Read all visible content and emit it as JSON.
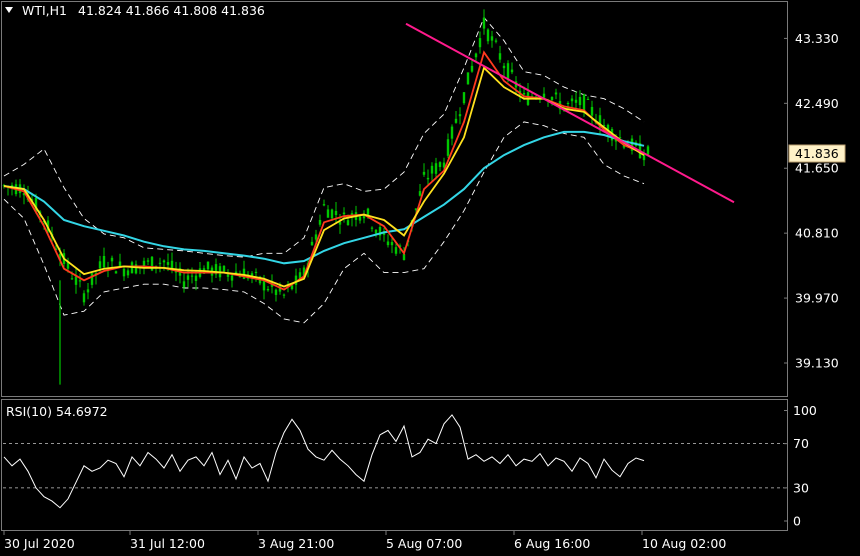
{
  "header": {
    "symbol": "WTI,H1",
    "ohlc": "41.824 41.866 41.808 41.836"
  },
  "price_badge": "41.836",
  "rsi_label": "RSI(10) 54.6972",
  "colors": {
    "background": "#000000",
    "candles": "#00c800",
    "ma_fast": "#ff3a1e",
    "ma_mid": "#ffe11e",
    "ma_slow": "#33d6e6",
    "bands": "#ffffff",
    "trendline": "#ff1a8c",
    "rsi": "#ffffff",
    "badge_bg": "#fff2c8"
  },
  "chart_data": [
    {
      "type": "line",
      "panel": "price",
      "symbol": "WTI,H1",
      "yticks": [
        43.33,
        42.49,
        41.65,
        40.81,
        39.97,
        39.13
      ],
      "yticks_text": [
        "43.330",
        "42.490",
        "41.650",
        "40.810",
        "39.970",
        "39.130"
      ],
      "ylim": [
        38.77,
        43.54
      ],
      "xticks": [
        "30 Jul 2020",
        "31 Jul 12:00",
        "3 Aug 21:00",
        "5 Aug 07:00",
        "6 Aug 16:00",
        "10 Aug 02:00"
      ],
      "current_price": 41.836,
      "series": [
        {
          "name": "",
          "role": "close",
          "x": [
            0,
            5,
            10,
            15,
            20,
            25,
            30,
            35,
            40,
            45,
            50,
            55,
            60,
            65,
            70,
            75,
            80,
            85,
            90,
            95,
            100,
            105,
            110,
            115,
            120,
            125,
            130,
            135,
            140,
            145,
            150,
            155,
            160
          ],
          "values": [
            41.42,
            41.4,
            41.0,
            40.45,
            40.02,
            40.45,
            40.35,
            40.4,
            40.45,
            40.2,
            40.35,
            40.3,
            40.3,
            40.15,
            40.0,
            40.28,
            41.15,
            41.0,
            41.1,
            40.75,
            40.55,
            41.5,
            41.75,
            42.6,
            43.5,
            43.0,
            42.55,
            42.65,
            42.45,
            42.5,
            42.2,
            42.0,
            41.84
          ]
        },
        {
          "name": "",
          "role": "ma_fast",
          "x": [
            0,
            5,
            10,
            15,
            20,
            25,
            30,
            35,
            40,
            45,
            50,
            55,
            60,
            65,
            70,
            75,
            80,
            85,
            90,
            95,
            100,
            105,
            110,
            115,
            120,
            125,
            130,
            135,
            140,
            145,
            150,
            155,
            160
          ],
          "values": [
            41.42,
            41.35,
            40.9,
            40.35,
            40.2,
            40.32,
            40.38,
            40.38,
            40.36,
            40.3,
            40.3,
            40.3,
            40.25,
            40.2,
            40.08,
            40.25,
            40.95,
            41.03,
            41.05,
            40.9,
            40.55,
            41.38,
            41.62,
            42.25,
            43.15,
            42.78,
            42.58,
            42.55,
            42.45,
            42.4,
            42.15,
            41.95,
            41.84
          ]
        },
        {
          "name": "",
          "role": "ma_mid",
          "x": [
            0,
            5,
            10,
            15,
            20,
            25,
            30,
            35,
            40,
            45,
            50,
            55,
            60,
            65,
            70,
            75,
            80,
            85,
            90,
            95,
            100,
            105,
            110,
            115,
            120,
            125,
            130,
            135,
            140,
            145,
            150,
            155,
            160
          ],
          "values": [
            41.42,
            41.38,
            40.98,
            40.48,
            40.28,
            40.35,
            40.38,
            40.36,
            40.36,
            40.33,
            40.32,
            40.3,
            40.27,
            40.22,
            40.12,
            40.22,
            40.85,
            41.0,
            41.05,
            40.98,
            40.78,
            41.22,
            41.58,
            42.05,
            42.95,
            42.7,
            42.55,
            42.55,
            42.42,
            42.38,
            42.18,
            41.98,
            41.82
          ]
        },
        {
          "name": "",
          "role": "ma_slow",
          "x": [
            0,
            5,
            10,
            15,
            20,
            25,
            30,
            35,
            40,
            45,
            50,
            55,
            60,
            65,
            70,
            75,
            80,
            85,
            90,
            95,
            100,
            105,
            110,
            115,
            120,
            125,
            130,
            135,
            140,
            145,
            150,
            155,
            160
          ],
          "values": [
            41.42,
            41.38,
            41.22,
            40.98,
            40.9,
            40.84,
            40.78,
            40.7,
            40.64,
            40.6,
            40.58,
            40.55,
            40.52,
            40.48,
            40.42,
            40.45,
            40.58,
            40.68,
            40.75,
            40.82,
            40.86,
            41.02,
            41.18,
            41.38,
            41.65,
            41.82,
            41.95,
            42.05,
            42.12,
            42.12,
            42.08,
            42.0,
            41.94
          ]
        },
        {
          "name": "",
          "role": "band_upper",
          "x": [
            0,
            5,
            10,
            15,
            20,
            25,
            30,
            35,
            40,
            45,
            50,
            55,
            60,
            65,
            70,
            75,
            80,
            85,
            90,
            95,
            100,
            105,
            110,
            115,
            120,
            125,
            130,
            135,
            140,
            145,
            150,
            155,
            160
          ],
          "values": [
            41.55,
            41.7,
            41.9,
            41.4,
            41.0,
            40.8,
            40.75,
            40.62,
            40.6,
            40.58,
            40.55,
            40.52,
            40.5,
            40.55,
            40.55,
            40.75,
            41.4,
            41.45,
            41.35,
            41.38,
            41.6,
            42.1,
            42.35,
            42.95,
            43.6,
            43.3,
            42.9,
            42.85,
            42.7,
            42.6,
            42.55,
            42.42,
            42.25
          ]
        },
        {
          "name": "",
          "role": "band_lower",
          "x": [
            0,
            5,
            10,
            15,
            20,
            25,
            30,
            35,
            40,
            45,
            50,
            55,
            60,
            65,
            70,
            75,
            80,
            85,
            90,
            95,
            100,
            105,
            110,
            115,
            120,
            125,
            130,
            135,
            140,
            145,
            150,
            155,
            160
          ],
          "values": [
            41.25,
            41.0,
            40.4,
            39.75,
            39.8,
            40.05,
            40.1,
            40.15,
            40.15,
            40.1,
            40.1,
            40.08,
            40.05,
            39.9,
            39.7,
            39.65,
            39.9,
            40.35,
            40.55,
            40.3,
            40.3,
            40.35,
            40.7,
            41.1,
            41.6,
            42.05,
            42.25,
            42.2,
            42.1,
            42.05,
            41.7,
            41.55,
            41.45
          ]
        }
      ],
      "trendline": {
        "x": [
          95,
          164
        ],
        "values": [
          43.52,
          41.65
        ]
      }
    },
    {
      "type": "line",
      "panel": "rsi",
      "title": "RSI(10) 54.6972",
      "yticks": [
        100,
        70,
        30,
        0
      ],
      "ylim": [
        0,
        100
      ],
      "levels": [
        70,
        30
      ],
      "series": [
        {
          "name": "RSI(10)",
          "x": [
            0,
            2,
            4,
            6,
            8,
            10,
            12,
            14,
            16,
            18,
            20,
            22,
            24,
            26,
            28,
            30,
            32,
            34,
            36,
            38,
            40,
            42,
            44,
            46,
            48,
            50,
            52,
            54,
            56,
            58,
            60,
            62,
            64,
            66,
            68,
            70,
            72,
            74,
            76,
            78,
            80,
            82,
            84,
            86,
            88,
            90,
            92,
            94,
            96,
            98,
            100,
            102,
            104,
            106,
            108,
            110,
            112,
            114,
            116,
            118,
            120,
            122,
            124,
            126,
            128,
            130,
            132,
            134,
            136,
            138,
            140,
            142,
            144,
            146,
            148,
            150,
            152,
            154,
            156,
            158,
            160
          ],
          "values": [
            58,
            50,
            56,
            45,
            30,
            22,
            18,
            12,
            20,
            35,
            50,
            45,
            48,
            55,
            52,
            40,
            58,
            50,
            62,
            56,
            48,
            60,
            45,
            55,
            58,
            50,
            62,
            42,
            55,
            38,
            58,
            48,
            52,
            36,
            62,
            80,
            92,
            82,
            65,
            58,
            55,
            64,
            56,
            50,
            42,
            36,
            60,
            78,
            82,
            72,
            86,
            58,
            62,
            74,
            70,
            88,
            96,
            85,
            56,
            60,
            54,
            58,
            52,
            60,
            50,
            56,
            54,
            61,
            50,
            57,
            54,
            45,
            57,
            52,
            39,
            56,
            46,
            40,
            52,
            57,
            54.7
          ]
        }
      ]
    }
  ]
}
